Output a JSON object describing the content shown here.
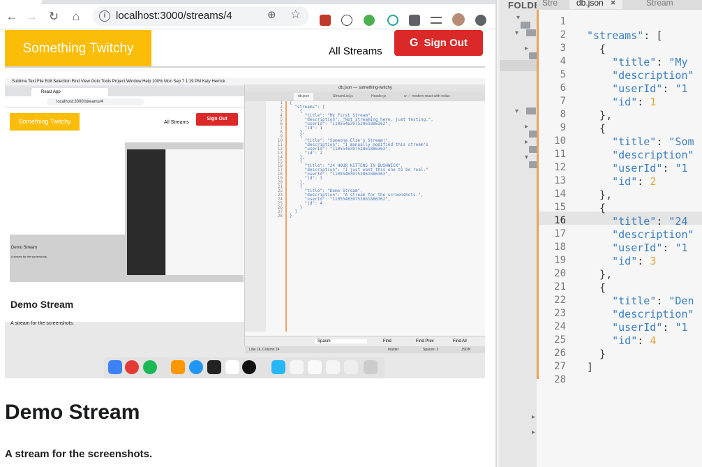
{
  "browser": {
    "url": "localhost:3000/streams/4",
    "back_icon": "arrow-left-icon",
    "forward_icon": "arrow-right-icon",
    "reload_icon": "reload-icon",
    "home_icon": "home-icon"
  },
  "app": {
    "brand": "Something Twitchy",
    "all_streams": "All Streams",
    "sign_out": "Sign Out",
    "sign_out_icon": "G",
    "stream_title": "Demo Stream",
    "stream_description": "A stream for the screenshots."
  },
  "embedded": {
    "menu_bar": "Sublime Text   File   Edit   Selection   Find   View   Goto   Tools   Project   Window   Help                                                                         100%   Mon Sep 7  1:19 PM   Katy Herrick",
    "tab": "React App",
    "url": "localhost:3000/streams/4",
    "brand": "Something Twitchy",
    "all_streams": "All Streams",
    "sign_out": "Sign Out",
    "thumb_title": "Demo Stream",
    "thumb_desc": "A stream for the screenshots.",
    "title": "Demo Stream",
    "desc": "A stream for the screenshots.",
    "editor_title": "db.json — something-twitchy",
    "editor_tabs": [
      "db.json",
      "StreamList.js",
      "Header.js",
      "w — modern-react-with-redux"
    ],
    "editor_line_numbers": "1\n2\n3\n4\n5\n6\n7\n8\n9\n10\n11\n12\n13\n14\n15\n16\n17\n18\n19\n20\n21\n22\n23\n24\n25\n26\n27\n28",
    "editor_code": "{\n  \"streams\": [\n    {\n      \"title\": \"My First Stream\",\n      \"description\": \"Not streaming here, just testing.\",\n      \"userId\": \"110554639752861886362\",\n      \"id\": 1\n    },\n    {\n      \"title\": \"Someone Else's Stream!\",\n      \"description\": \"I manually modified this stream's\n      \"userId\": \"110554639752861886363\",\n      \"id\": 2\n    },\n    {\n      \"title\": \"24 HOUR KITTENS IN BUSHWICK\",\n      \"description\": \"I just want this one to be real.\"\n      \"userId\": \"110554639752861886363\",\n      \"id\": 3\n    },\n    {\n      \"title\": \"Demo Stream\",\n      \"description\": \"A stream for the screenshots.\",\n      \"userId\": \"110554639752861886362\",\n      \"id\": 4\n    }\n  ]\n}",
    "find_value": "Spasm",
    "find_label": "Find",
    "find_prev": "Find Prev",
    "find_all": "Find All",
    "status": "Line 16, Column 24",
    "status_branch": "master",
    "status_spaces": "Spaces: 2",
    "status_syntax": "JSON"
  },
  "sublime": {
    "folders_label": "FOLDE",
    "tabs": [
      "Stre",
      "db.json",
      "Stream"
    ],
    "active_tab": "db.json",
    "close_glyph": "×",
    "line_numbers": [
      "1",
      "2",
      "3",
      "4",
      "5",
      "6",
      "7",
      "8",
      "9",
      "10",
      "11",
      "12",
      "13",
      "14",
      "15",
      "16",
      "17",
      "18",
      "19",
      "20",
      "21",
      "22",
      "23",
      "24",
      "25",
      "26",
      "27",
      "28"
    ],
    "current_line": "16",
    "code_lines": [
      "",
      "\"streams\": [",
      "  {",
      "    \"title\": \"My",
      "    \"description\"",
      "    \"userId\": \"1",
      "    \"id\": 1",
      "  },",
      "  {",
      "    \"title\": \"Som",
      "    \"description\"",
      "    \"userId\": \"1",
      "    \"id\": 2",
      "  },",
      "  {",
      "    \"title\": \"24",
      "    \"description\"",
      "    \"userId\": \"1",
      "    \"id\": 3",
      "  },",
      "  {",
      "    \"title\": \"Den",
      "    \"description\"",
      "    \"userId\": \"1",
      "    \"id\": 4",
      "  }",
      "]",
      ""
    ]
  },
  "colors": {
    "brand_yellow": "#fbbd08",
    "sign_out_red": "#db2828",
    "sublime_key_blue": "#3a7fc1",
    "sublime_number_orange": "#e8a33a"
  }
}
